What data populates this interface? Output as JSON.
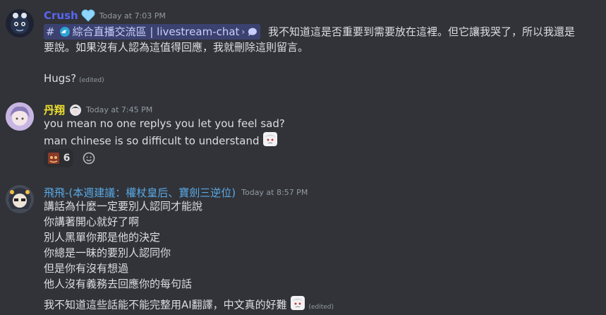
{
  "messages": [
    {
      "username": "Crush",
      "username_color": "#5865f2",
      "timestamp": "Today at 7:03 PM",
      "channel_mention": {
        "hash": "#",
        "name": "綜合直播交流區 | livestream-chat",
        "sep": "›"
      },
      "line1_text": "我不知道這是否重要到需要放在這裡。但它讓我哭了，所以我還是",
      "line2_text": "要說。如果沒有人認為這值得回應，我就刪除這則留言。",
      "line3_text": "Hugs?",
      "edited_label": "(edited)"
    },
    {
      "username": "丹翔",
      "username_color": "#f0e130",
      "timestamp": "Today at 7:45 PM",
      "line1_text": "you mean no one replys you let you feel sad?",
      "line2_text": "man chinese is so difficult to understand",
      "reaction_count": "6"
    },
    {
      "username": "飛飛-(本週建議：權杖皇后、寶劍三逆位)",
      "username_color": "#5aa9e6",
      "timestamp": "Today at 8:57 PM",
      "lines": [
        "講話為什麼一定要別人認同才能說",
        "你講著開心就好了啊",
        "別人黑單你那是他的決定",
        "你總是一昧的要別人認同你",
        "但是你有沒有想過",
        "他人沒有義務去回應你的每句話",
        "我不知道這些話能不能完整用AI翻譯，中文真的好難"
      ],
      "edited_label": "(edited)"
    }
  ]
}
